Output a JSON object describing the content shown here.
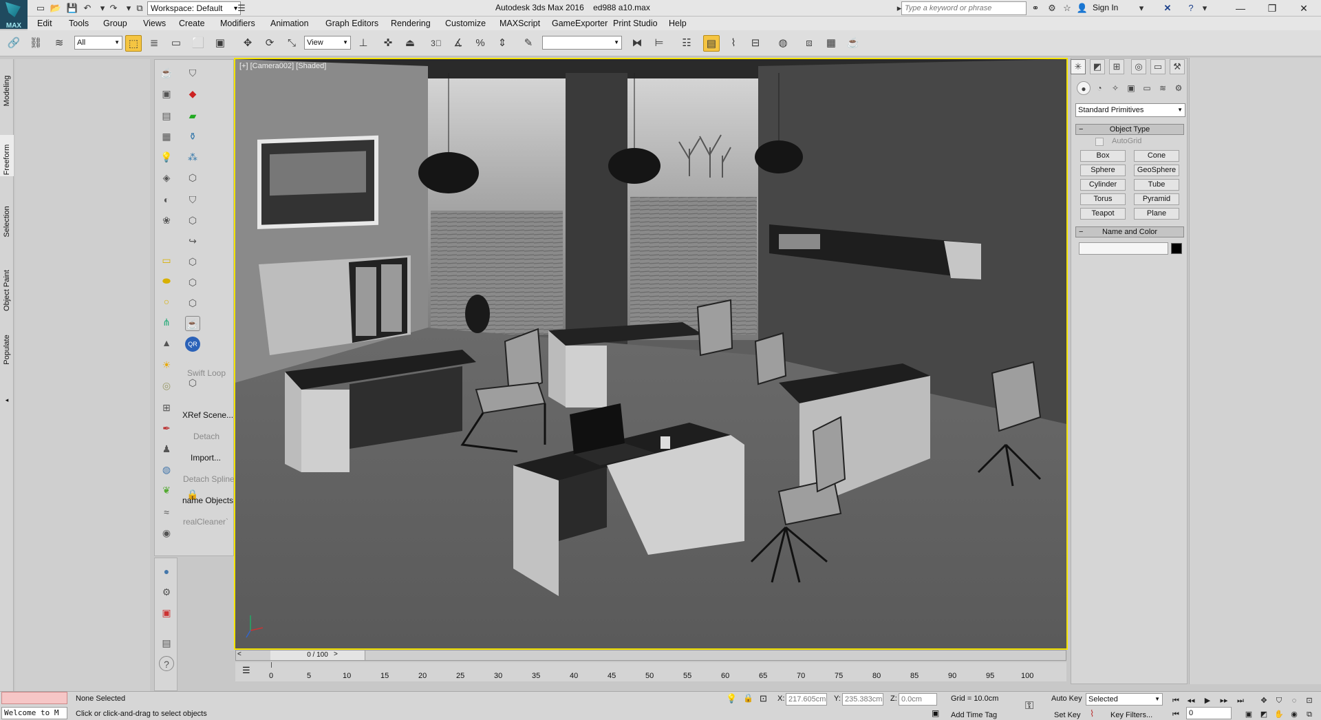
{
  "window": {
    "title": "Autodesk 3ds Max 2016",
    "file": "ed988 a10.max",
    "workspace": "Workspace: Default",
    "search_placeholder": "Type a keyword or phrase",
    "sign_in": "Sign In",
    "logo_text": "MAX"
  },
  "menu": [
    "Edit",
    "Tools",
    "Group",
    "Views",
    "Create",
    "Modifiers",
    "Animation",
    "Graph Editors",
    "Rendering",
    "Customize",
    "MAXScript",
    "GameExporter",
    "Print Studio",
    "Help"
  ],
  "toolbar": {
    "selection_filter": "All",
    "ref_coord": "View",
    "named_selection": ""
  },
  "left_ribbon": [
    "Modeling",
    "Freeform",
    "Selection",
    "Object Paint",
    "Populate"
  ],
  "command_labels": {
    "swift_loop": "Swift Loop",
    "xref_scene": "XRef Scene...",
    "detach": "Detach",
    "import": "Import...",
    "detach_spline": "Detach Spline",
    "rename_objects": "name Objects",
    "real_cleaner": "realCleaner`"
  },
  "viewport": {
    "label": "[+] [Camera002] [Shaded]",
    "border_color": "#f5e400"
  },
  "timeline": {
    "slider_text": "0 / 100",
    "ticks": [
      "0",
      "5",
      "10",
      "15",
      "20",
      "25",
      "30",
      "35",
      "40",
      "45",
      "50",
      "55",
      "60",
      "65",
      "70",
      "75",
      "80",
      "85",
      "90",
      "95",
      "100"
    ]
  },
  "command_panel": {
    "category": "Standard Primitives",
    "object_type_title": "Object Type",
    "autogrid": "AutoGrid",
    "buttons": [
      "Box",
      "Cone",
      "Sphere",
      "GeoSphere",
      "Cylinder",
      "Tube",
      "Torus",
      "Pyramid",
      "Teapot",
      "Plane"
    ],
    "name_color_title": "Name and Color",
    "object_color": "#000000"
  },
  "status": {
    "listener": "Welcome to M",
    "selection": "None Selected",
    "prompt": "Click or click-and-drag to select objects",
    "x_label": "X:",
    "x_value": "217.605cm",
    "y_label": "Y:",
    "y_value": "235.383cm",
    "z_label": "Z:",
    "z_value": "0.0cm",
    "grid": "Grid = 10.0cm",
    "add_time_tag": "Add Time Tag",
    "auto_key": "Auto Key",
    "set_key": "Set Key",
    "key_mode": "Selected",
    "key_filters": "Key Filters...",
    "frame": "0"
  }
}
